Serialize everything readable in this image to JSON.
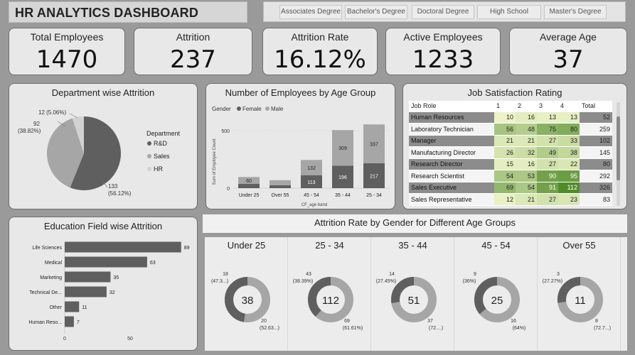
{
  "header": {
    "title": "HR ANALYTICS DASHBOARD"
  },
  "education_slicer": [
    "Associates Degree",
    "Bachelor's Degree",
    "Doctoral Degree",
    "High School",
    "Master's Degree"
  ],
  "kpis": [
    {
      "label": "Total Employees",
      "value": "1470"
    },
    {
      "label": "Attrition",
      "value": "237"
    },
    {
      "label": "Attrition Rate",
      "value": "16.12%"
    },
    {
      "label": "Active Employees",
      "value": "1233"
    },
    {
      "label": "Average Age",
      "value": "37"
    }
  ],
  "colors": {
    "dark": "#5f5f5f",
    "mid": "#a6a6a6",
    "light": "#d2d2d2",
    "panel": "#e8e8e8"
  },
  "chart_data": [
    {
      "id": "dept",
      "type": "pie",
      "title": "Department wise Attrition",
      "legend_title": "Department",
      "legend_position": "right",
      "slices": [
        {
          "name": "R&D",
          "value": 133,
          "label": "133",
          "pct": "(56.12%)"
        },
        {
          "name": "Sales",
          "value": 92,
          "label": "92",
          "pct": "(38.82%)"
        },
        {
          "name": "HR",
          "value": 12,
          "label": "12 (5.06%)",
          "pct": ""
        }
      ]
    },
    {
      "id": "age",
      "type": "bar",
      "stacked": true,
      "title": "Number of Employees by Age Group",
      "legend_title": "Gender",
      "legend": [
        "Female",
        "Male"
      ],
      "xlabel": "CF_age band",
      "ylabel": "Sum of Employee Count",
      "yticks": [
        0,
        500
      ],
      "ylim": [
        0,
        560
      ],
      "categories": [
        "Under 25",
        "Over 55",
        "45 - 54",
        "35 - 44",
        "25 - 34"
      ],
      "series": [
        {
          "name": "Female",
          "values": [
            37,
            26,
            113,
            196,
            217
          ],
          "labels": [
            "",
            "",
            "113",
            "196",
            "217"
          ]
        },
        {
          "name": "Male",
          "values": [
            60,
            43,
            132,
            309,
            337
          ],
          "labels": [
            "60",
            "",
            "132",
            "309",
            "337"
          ]
        }
      ]
    },
    {
      "id": "edu",
      "type": "bar",
      "orientation": "horizontal",
      "title": "Education Field wise Attrition",
      "categories": [
        "Life Sciences",
        "Medical",
        "Marketing",
        "Technical De...",
        "Other",
        "Human Reso..."
      ],
      "values": [
        89,
        63,
        35,
        32,
        11,
        7
      ],
      "xticks": [
        0,
        50
      ],
      "xlim": [
        0,
        100
      ]
    },
    {
      "id": "gender_donuts",
      "type": "pie",
      "title": "Attrition Rate by Gender for Different Age Groups",
      "groups": [
        {
          "name": "Under 25",
          "total": "38",
          "a_value": 18,
          "a_label": "18",
          "a_pct": "(47.3...)",
          "b_value": 20,
          "b_label": "20",
          "b_pct": "(52.63...)"
        },
        {
          "name": "25 - 34",
          "total": "112",
          "a_value": 43,
          "a_label": "43",
          "a_pct": "(38.39%)",
          "b_value": 69,
          "b_label": "69",
          "b_pct": "(61.61%)"
        },
        {
          "name": "35 - 44",
          "total": "51",
          "a_value": 14,
          "a_label": "14",
          "a_pct": "(27.45%)",
          "b_value": 37,
          "b_label": "37",
          "b_pct": "(72....)"
        },
        {
          "name": "45 - 54",
          "total": "25",
          "a_value": 9,
          "a_label": "9",
          "a_pct": "(36%)",
          "b_value": 16,
          "b_label": "16",
          "b_pct": "(64%)"
        },
        {
          "name": "Over 55",
          "total": "11",
          "a_value": 3,
          "a_label": "3",
          "a_pct": "(27.27%)",
          "b_value": 8,
          "b_label": "8",
          "b_pct": "(72.7...)"
        }
      ]
    }
  ],
  "job_satisfaction": {
    "title": "Job Satisfaction Rating",
    "columns": [
      "Job Role",
      "1",
      "2",
      "3",
      "4",
      "Total"
    ],
    "rows": [
      {
        "role": "Human Resources",
        "v": [
          "10",
          "16",
          "13",
          "13"
        ],
        "total": "52"
      },
      {
        "role": "Laboratory Technician",
        "v": [
          "56",
          "48",
          "75",
          "80"
        ],
        "total": "259"
      },
      {
        "role": "Manager",
        "v": [
          "21",
          "21",
          "27",
          "33"
        ],
        "total": "102"
      },
      {
        "role": "Manufacturing Director",
        "v": [
          "26",
          "32",
          "49",
          "38"
        ],
        "total": "145"
      },
      {
        "role": "Research Director",
        "v": [
          "15",
          "16",
          "27",
          "22"
        ],
        "total": "80"
      },
      {
        "role": "Research Scientist",
        "v": [
          "54",
          "53",
          "90",
          "95"
        ],
        "total": "292"
      },
      {
        "role": "Sales Executive",
        "v": [
          "69",
          "54",
          "91",
          "112"
        ],
        "total": "326"
      },
      {
        "role": "Sales Representative",
        "v": [
          "12",
          "21",
          "27",
          "23"
        ],
        "total": "83"
      }
    ]
  }
}
